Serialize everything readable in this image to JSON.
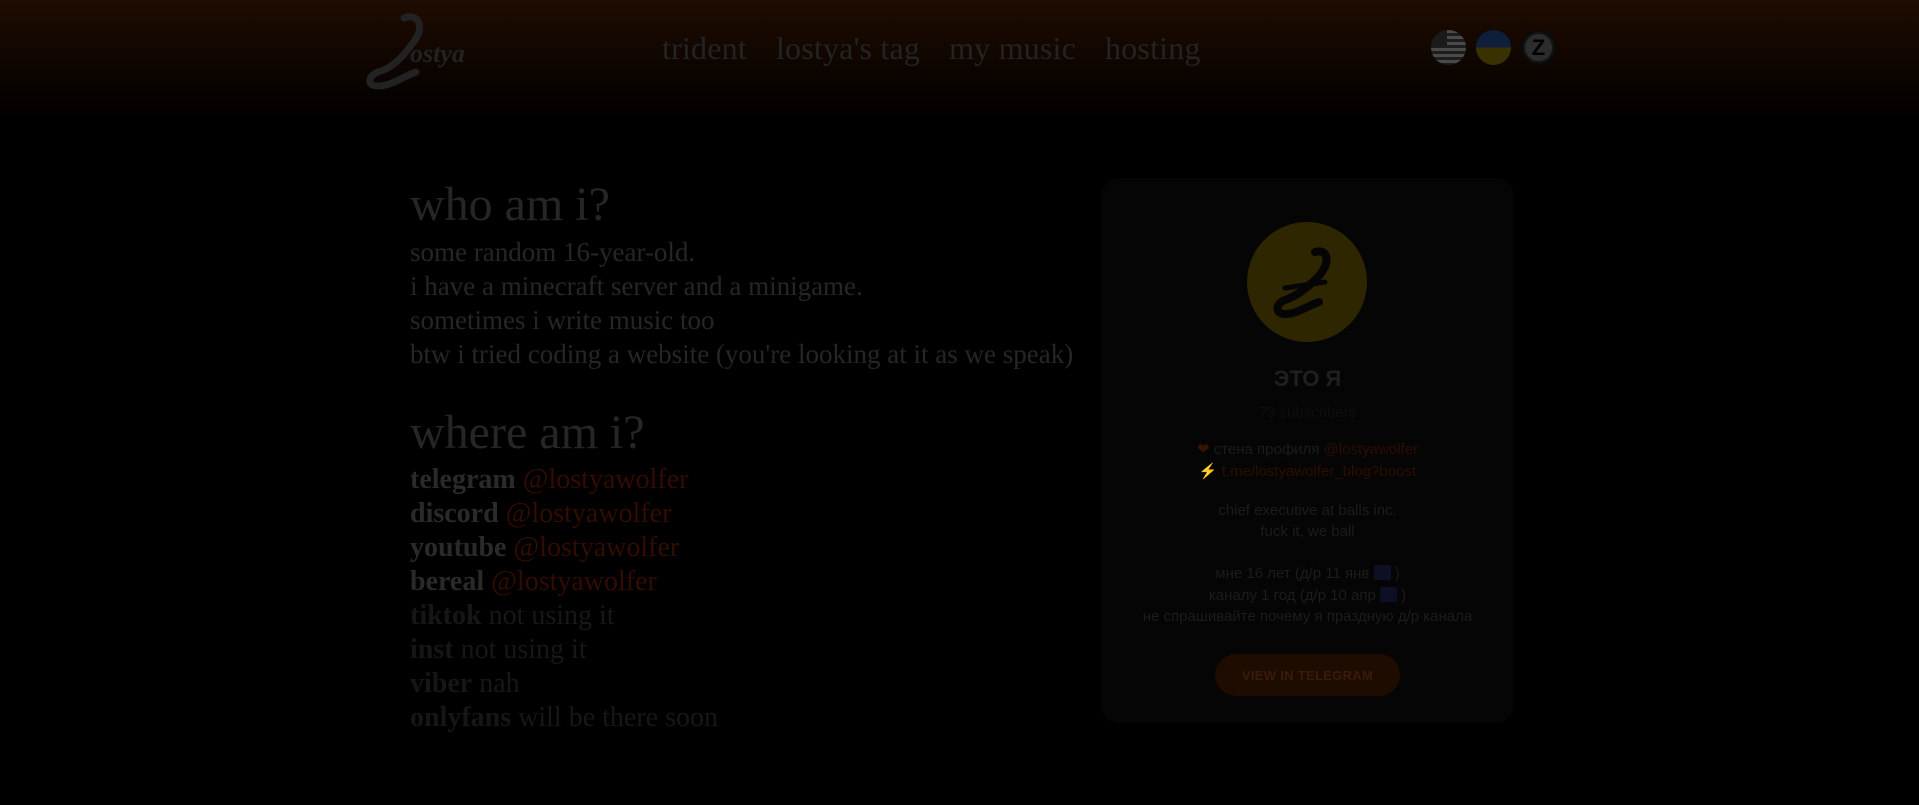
{
  "header": {
    "logo_text": "Lostya",
    "nav": [
      "trident",
      "lostya's tag",
      "my music",
      "hosting"
    ],
    "langs": [
      "us-flag-icon",
      "ua-flag-icon",
      "z-icon"
    ],
    "z_label": "Z"
  },
  "about": {
    "title": "who am i?",
    "lines": [
      "some random 16-year-old.",
      "i have a minecraft server and a minigame.",
      "sometimes i write music too",
      "btw i tried coding a website (you're looking at it as we speak)"
    ]
  },
  "where": {
    "title": "where am i?",
    "items": [
      {
        "label": "telegram",
        "value": "@lostyawolfer"
      },
      {
        "label": "discord",
        "value": "@lostyawolfer"
      },
      {
        "label": "youtube",
        "value": "@lostyawolfer"
      },
      {
        "label": "bereal",
        "value": "@lostyawolfer"
      },
      {
        "label": "tiktok",
        "value": "not using it"
      },
      {
        "label": "inst",
        "value": "not using it"
      },
      {
        "label": "viber",
        "value": "nah"
      },
      {
        "label": "onlyfans",
        "value": "will be there soon"
      }
    ]
  },
  "card": {
    "name": "ЭТО Я",
    "subscribers": "73 subscribers",
    "wall_text": "стена профиля",
    "wall_link": "@lostyawolfer",
    "boost_link": "t.me/lostyawolfer_blog?boost",
    "bio1": "chief executive at balls inc.",
    "bio2": "fuck it, we ball",
    "age_pre": "мне 16 лет (д/р 11 янв",
    "age_post": ")",
    "channel_pre": "каналу 1 год (д/р 10 апр",
    "channel_post": ")",
    "note": "не спрашивайте почему я праздную д/р канала",
    "button": "VIEW IN TELEGRAM",
    "avatar_letter": "L"
  },
  "colors": {
    "accent": "#330c00",
    "avatar_bg": "#2d2600",
    "button_bg": "#1f0c00"
  }
}
